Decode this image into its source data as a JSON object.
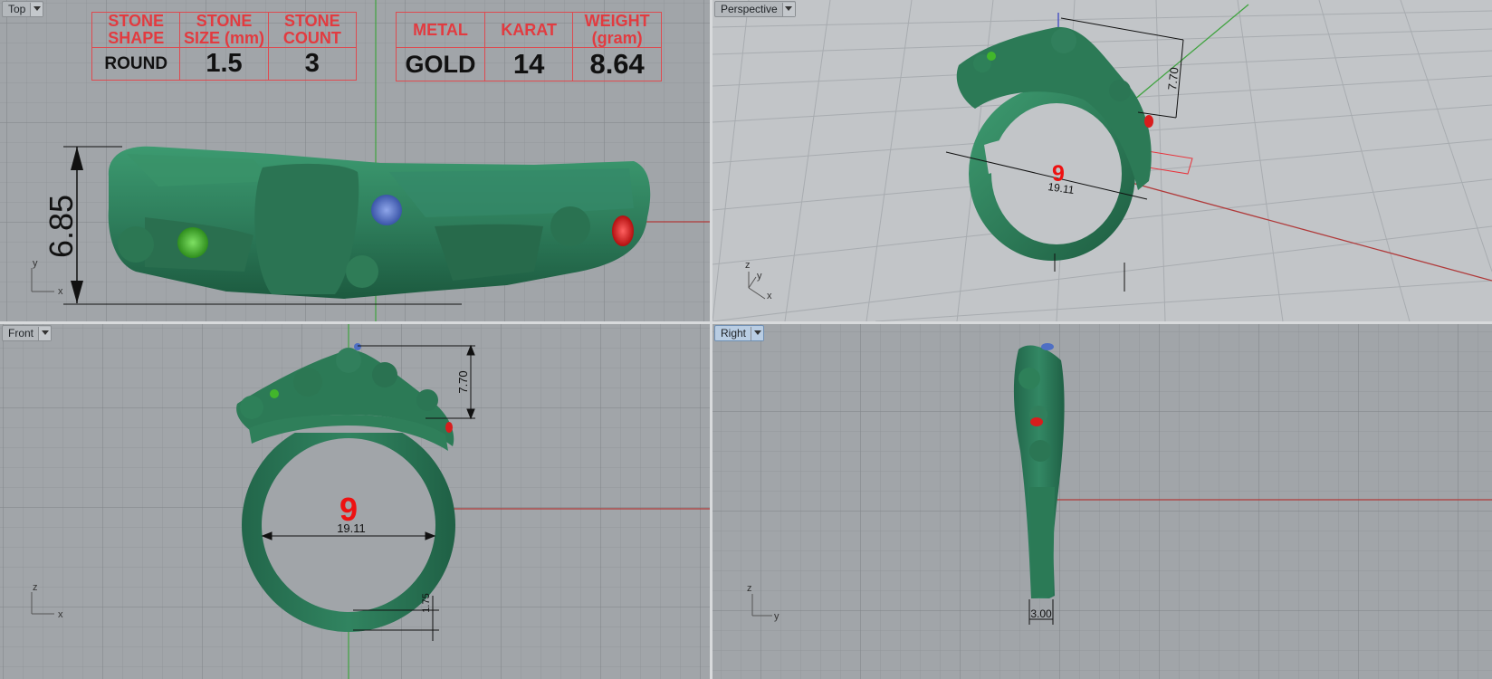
{
  "viewports": {
    "top": {
      "label": "Top"
    },
    "perspective": {
      "label": "Perspective"
    },
    "front": {
      "label": "Front"
    },
    "right": {
      "label": "Right"
    }
  },
  "spec_stone": {
    "headers": [
      "STONE SHAPE",
      "STONE SIZE (mm)",
      "STONE COUNT"
    ],
    "values": [
      "ROUND",
      "1.5",
      "3"
    ]
  },
  "spec_metal": {
    "headers": [
      "METAL",
      "KARAT",
      "WEIGHT (gram)"
    ],
    "values": [
      "GOLD",
      "14",
      "8.64"
    ]
  },
  "dimensions": {
    "top_width": "6.85",
    "head_height": "7.70",
    "inner_diameter": "19.11",
    "ring_size": "9",
    "shank_thickness": "1.75",
    "shank_width": "3.00"
  },
  "axes": {
    "x": "x",
    "y": "y",
    "z": "z"
  },
  "colors": {
    "metal": "#2e7d5b",
    "metal_dark": "#1f5e43",
    "stone_green": "#3fae2a",
    "stone_blue": "#4f6fc4",
    "stone_red": "#d81d1d",
    "annotation_red": "#e8323a",
    "viewport_bg": "#a1a5a9",
    "grid": "#8f9498",
    "x_axis": "#b03a3a",
    "y_axis": "#3fa33f",
    "z_axis": "#3b46c2"
  },
  "icons": [
    "chevron-down-icon",
    "axis-gizmo-icon"
  ]
}
